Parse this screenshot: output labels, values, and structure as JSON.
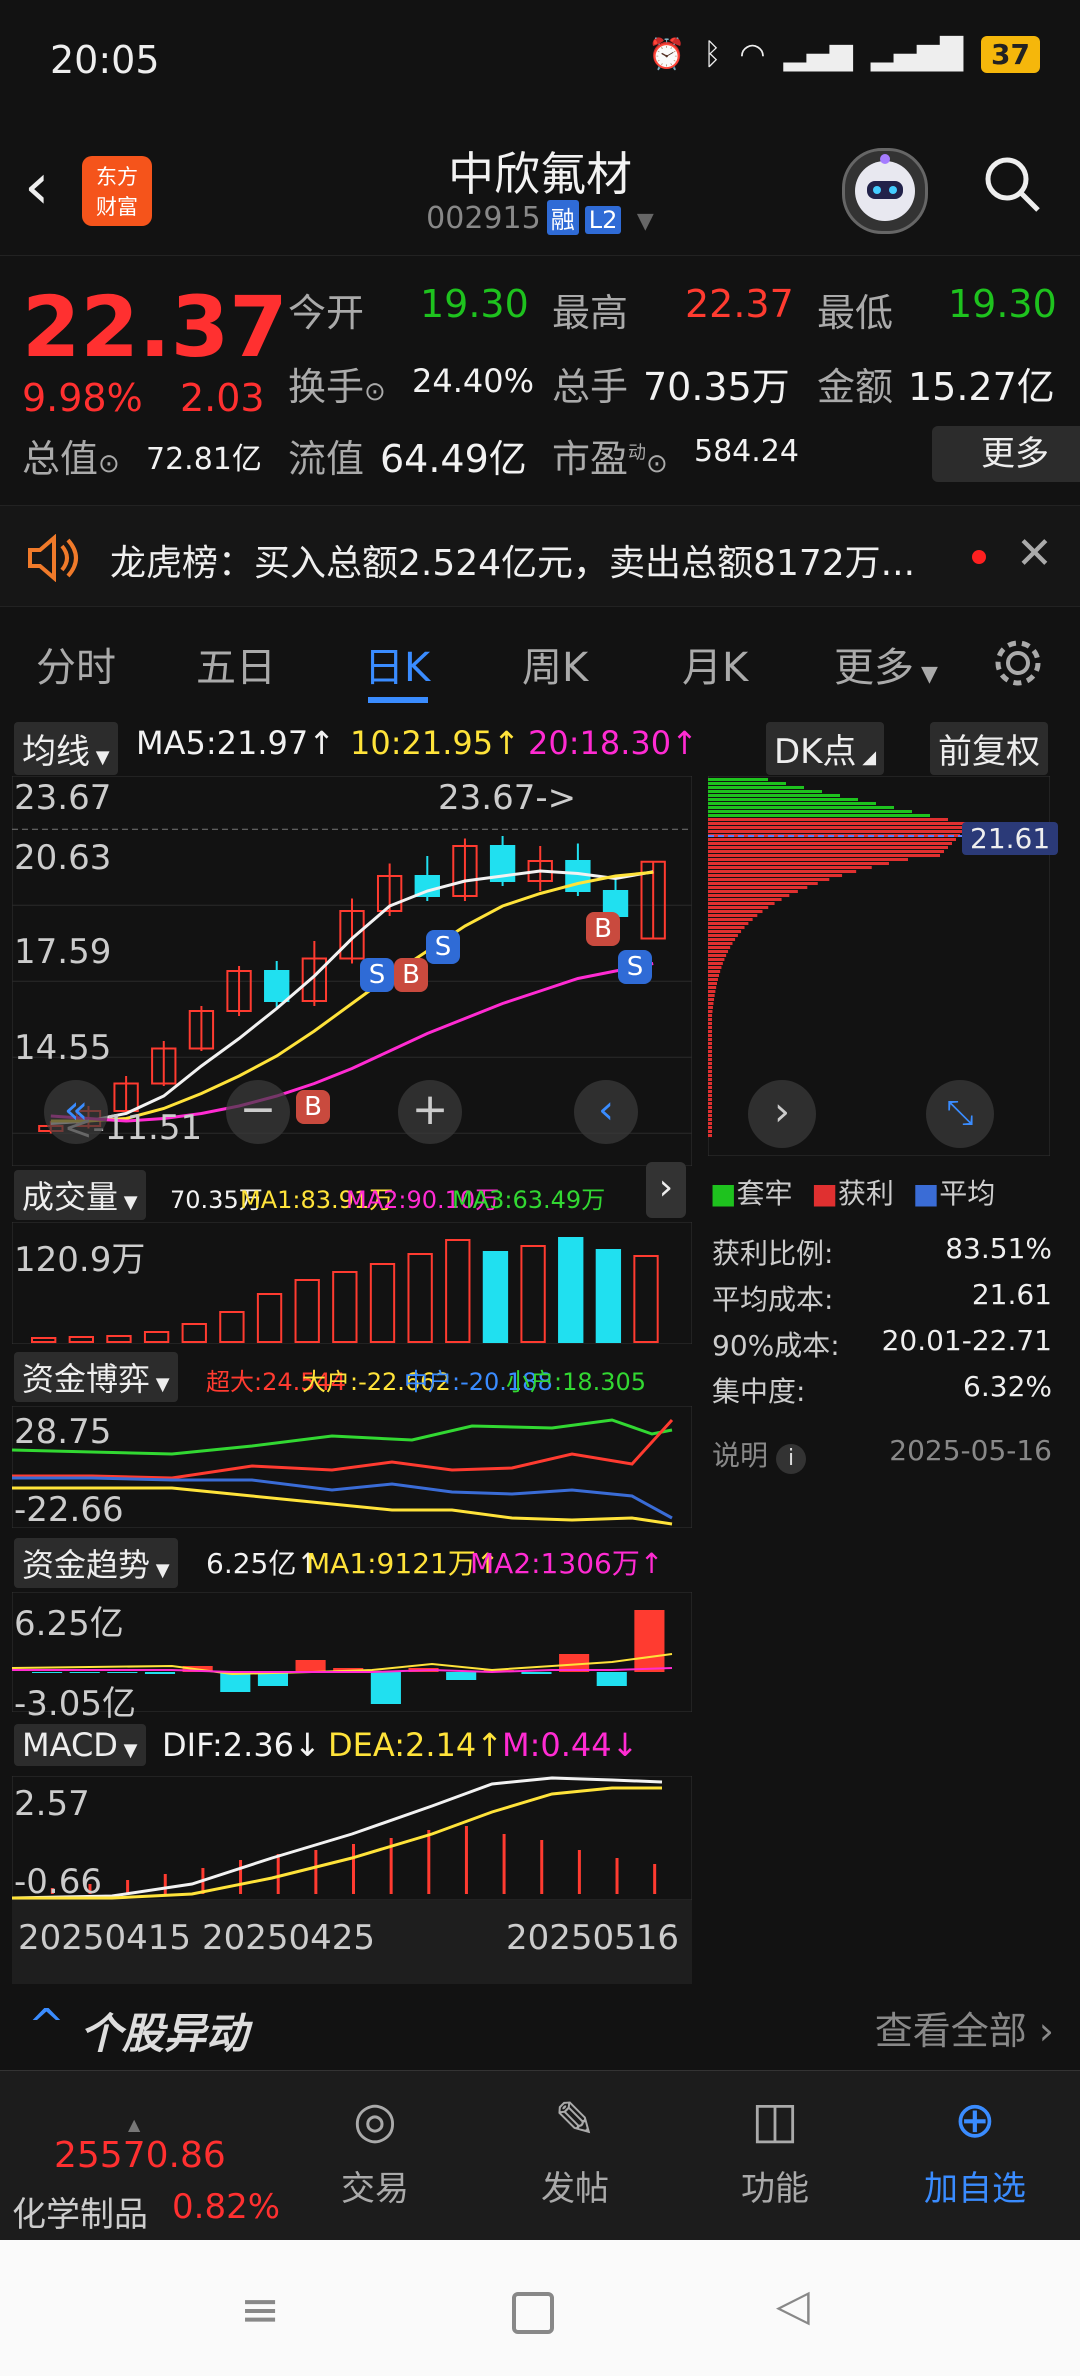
{
  "status": {
    "time": "20:05",
    "battery": "37"
  },
  "header": {
    "logo_line1": "东方",
    "logo_line2": "财富",
    "name": "中欣氟材",
    "code": "002915",
    "tag_margin": "融",
    "tag_level": "L2"
  },
  "quote": {
    "price": "22.37",
    "change_pct": "9.98%",
    "change": "2.03",
    "open_label": "今开",
    "open": "19.30",
    "high_label": "最高",
    "high": "22.37",
    "low_label": "最低",
    "low": "19.30",
    "turnover_label": "换手",
    "turnover": "24.40%",
    "volume_label": "总手",
    "volume": "70.35万",
    "amount_label": "金额",
    "amount": "15.27亿",
    "mktcap_label": "总值",
    "mktcap": "72.81亿",
    "float_label": "流值",
    "float": "64.49亿",
    "pe_label": "市盈",
    "pe_sup": "动",
    "pe": "584.24",
    "more": "更多"
  },
  "news": {
    "text": "龙虎榜：买入总额2.524亿元，卖出总额8172万..."
  },
  "tabs": [
    "分时",
    "五日",
    "日K",
    "周K",
    "月K",
    "更多"
  ],
  "active_tab": 2,
  "chart": {
    "ma_button": "均线",
    "ma5": "MA5:21.97",
    "ma10": "10:21.95",
    "ma20": "20:18.30",
    "dk_button": "DK点",
    "adjust_button": "前复权",
    "y_labels": [
      "23.67",
      "20.63",
      "17.59",
      "14.55",
      "11.51"
    ],
    "high_marker": "23.67->",
    "low_marker": "11.51",
    "cost_price": "21.61",
    "volume_panel": {
      "label": "成交量",
      "vol": "70.35万",
      "ma1": "MA1:83.91万",
      "ma2": "MA2:90.10万",
      "ma3": "MA3:63.49万",
      "y_top": "120.9万"
    },
    "fund_game": {
      "label": "资金博弈",
      "super": "超大:24.544",
      "big": "大户:-22.662",
      "mid": "中户:-20.188",
      "small": "小户:18.305",
      "y_top": "28.75",
      "y_bot": "-22.66"
    },
    "fund_trend": {
      "label": "资金趋势",
      "val": "6.25亿",
      "ma1": "MA1:9121万",
      "ma2": "MA2:1306万",
      "y_top": "6.25亿",
      "y_bot": "-3.05亿"
    },
    "macd": {
      "label": "MACD",
      "dif": "DIF:2.36",
      "dea": "DEA:2.14",
      "m": "M:0.44",
      "y_top": "2.57",
      "y_bot": "-0.66"
    },
    "dates": [
      "20250415",
      "20250425",
      "20250516"
    ],
    "signals": [
      "S",
      "B",
      "S",
      "B",
      "S",
      "B"
    ]
  },
  "chip": {
    "legend": [
      "套牢",
      "获利",
      "平均"
    ],
    "rows": [
      {
        "k": "获利比例:",
        "v": "83.51%"
      },
      {
        "k": "平均成本:",
        "v": "21.61"
      },
      {
        "k": "90%成本:",
        "v": "20.01-22.71"
      },
      {
        "k": "集中度:",
        "v": "6.32%"
      }
    ],
    "note": "说明",
    "date": "2025-05-16"
  },
  "movement": {
    "title": "个股异动",
    "link": "查看全部"
  },
  "bottom": {
    "index_value": "25570.86",
    "index_name": "化学制品",
    "index_pct": "0.82%",
    "nav": [
      "交易",
      "发帖",
      "功能",
      "加自选"
    ]
  },
  "chart_data": {
    "type": "candlestick",
    "x_ticks": [
      "20250415",
      "20250425",
      "20250516"
    ],
    "ylim": [
      11.51,
      23.67
    ],
    "y_ticks": [
      23.67,
      20.63,
      17.59,
      14.55,
      11.51
    ],
    "ma": {
      "MA5": 21.97,
      "MA10": 21.95,
      "MA20": 18.3
    },
    "series": [
      {
        "name": "MA5",
        "values": [
          11.9,
          12.0,
          12.3,
          13.0,
          14.2,
          15.3,
          16.5,
          17.8,
          19.3,
          20.6,
          21.2,
          21.6,
          21.8,
          22.0,
          21.9,
          21.7,
          21.97
        ]
      },
      {
        "name": "MA10",
        "values": [
          12.0,
          12.0,
          12.1,
          12.5,
          13.1,
          13.8,
          14.6,
          15.6,
          16.7,
          17.8,
          18.8,
          19.8,
          20.6,
          21.1,
          21.5,
          21.8,
          21.95
        ]
      },
      {
        "name": "MA20",
        "values": [
          12.2,
          12.1,
          12.0,
          12.1,
          12.3,
          12.6,
          13.0,
          13.5,
          14.1,
          14.8,
          15.5,
          16.1,
          16.7,
          17.2,
          17.7,
          18.0,
          18.3
        ]
      }
    ],
    "candles": [
      [
        11.6,
        11.8,
        11.5,
        12.0
      ],
      [
        11.8,
        12.4,
        11.7,
        12.6
      ],
      [
        12.4,
        13.5,
        12.3,
        13.8
      ],
      [
        13.5,
        14.9,
        13.4,
        15.2
      ],
      [
        14.9,
        16.4,
        14.8,
        16.6
      ],
      [
        16.4,
        18.0,
        16.2,
        18.2
      ],
      [
        18.0,
        16.8,
        16.5,
        18.4
      ],
      [
        16.8,
        18.5,
        16.6,
        19.2
      ],
      [
        18.5,
        20.4,
        18.3,
        20.9
      ],
      [
        20.4,
        21.8,
        20.2,
        22.3
      ],
      [
        21.8,
        21.0,
        20.8,
        22.6
      ],
      [
        21.0,
        23.0,
        20.8,
        23.3
      ],
      [
        23.0,
        21.6,
        21.4,
        23.4
      ],
      [
        21.6,
        22.4,
        21.2,
        23.0
      ],
      [
        22.4,
        21.2,
        21.0,
        23.1
      ],
      [
        21.2,
        20.2,
        19.8,
        21.7
      ],
      [
        19.3,
        22.37,
        19.3,
        22.37
      ]
    ]
  }
}
